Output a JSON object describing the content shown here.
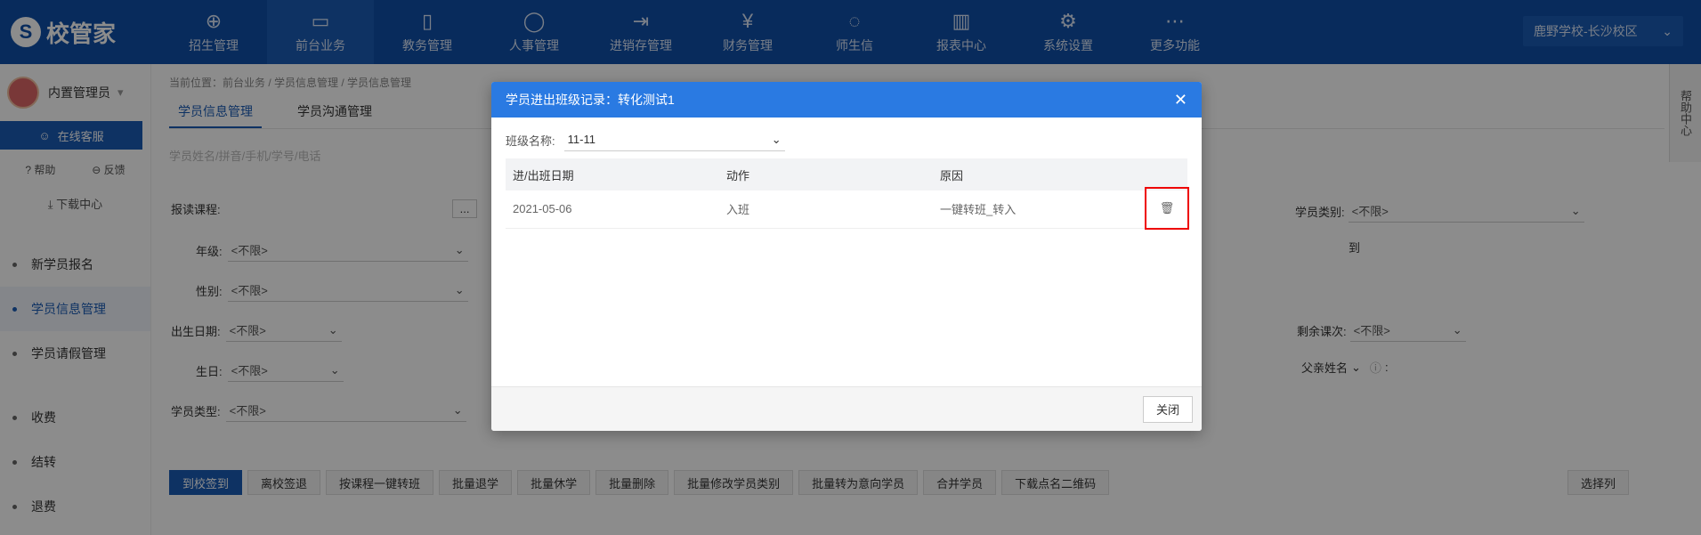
{
  "app": {
    "logo": "校管家"
  },
  "nav": [
    {
      "label": "招生管理",
      "icon": "person-add-icon",
      "glyph": "⊕"
    },
    {
      "label": "前台业务",
      "icon": "desk-icon",
      "glyph": "▭"
    },
    {
      "label": "教务管理",
      "icon": "book-icon",
      "glyph": "▯"
    },
    {
      "label": "人事管理",
      "icon": "person-icon",
      "glyph": "◯"
    },
    {
      "label": "进销存管理",
      "icon": "inbox-icon",
      "glyph": "⇥"
    },
    {
      "label": "财务管理",
      "icon": "money-icon",
      "glyph": "¥"
    },
    {
      "label": "师生信",
      "icon": "chat-icon",
      "glyph": "◌"
    },
    {
      "label": "报表中心",
      "icon": "chart-icon",
      "glyph": "▥"
    },
    {
      "label": "系统设置",
      "icon": "gear-icon",
      "glyph": "⚙"
    },
    {
      "label": "更多功能",
      "icon": "more-icon",
      "glyph": "⋯"
    }
  ],
  "campus": "鹿野学校-长沙校区",
  "sidebar": {
    "username": "内置管理员",
    "online_service": "在线客服",
    "help": "帮助",
    "feedback": "反馈",
    "download": "下载中心",
    "items": [
      {
        "label": "新学员报名"
      },
      {
        "label": "学员信息管理"
      },
      {
        "label": "学员请假管理"
      },
      {
        "label": "收费"
      },
      {
        "label": "结转"
      },
      {
        "label": "退费"
      }
    ]
  },
  "main": {
    "breadcrumb": "当前位置：前台业务 / 学员信息管理 / 学员信息管理",
    "tabs": [
      "学员信息管理",
      "学员沟通管理"
    ],
    "search_placeholder": "学员姓名/拼音/手机/学号/电话",
    "filters": {
      "course": "报读课程:",
      "course_btn": "...",
      "grade": "年级:",
      "gender": "性别:",
      "birth_date": "出生日期:",
      "birthday": "生日:",
      "student_type": "学员类型:",
      "not_limited": "<不限>",
      "student_category": "学员类别:",
      "to": "到",
      "remaining": "剩余课次:",
      "father_name": "父亲姓名"
    },
    "toolbar": [
      "到校签到",
      "离校签退",
      "按课程一键转班",
      "批量退学",
      "批量休学",
      "批量删除",
      "批量修改学员类别",
      "批量转为意向学员",
      "合并学员",
      "下载点名二维码"
    ],
    "select_columns": "选择列"
  },
  "right_help": "帮助中心",
  "modal": {
    "title": "学员进出班级记录：转化测试1",
    "class_label": "班级名称:",
    "class_value": "11-11",
    "columns": [
      "进/出班日期",
      "动作",
      "原因"
    ],
    "rows": [
      {
        "date": "2021-05-06",
        "action": "入班",
        "reason": "一键转班_转入"
      }
    ],
    "close_label": "关闭"
  }
}
